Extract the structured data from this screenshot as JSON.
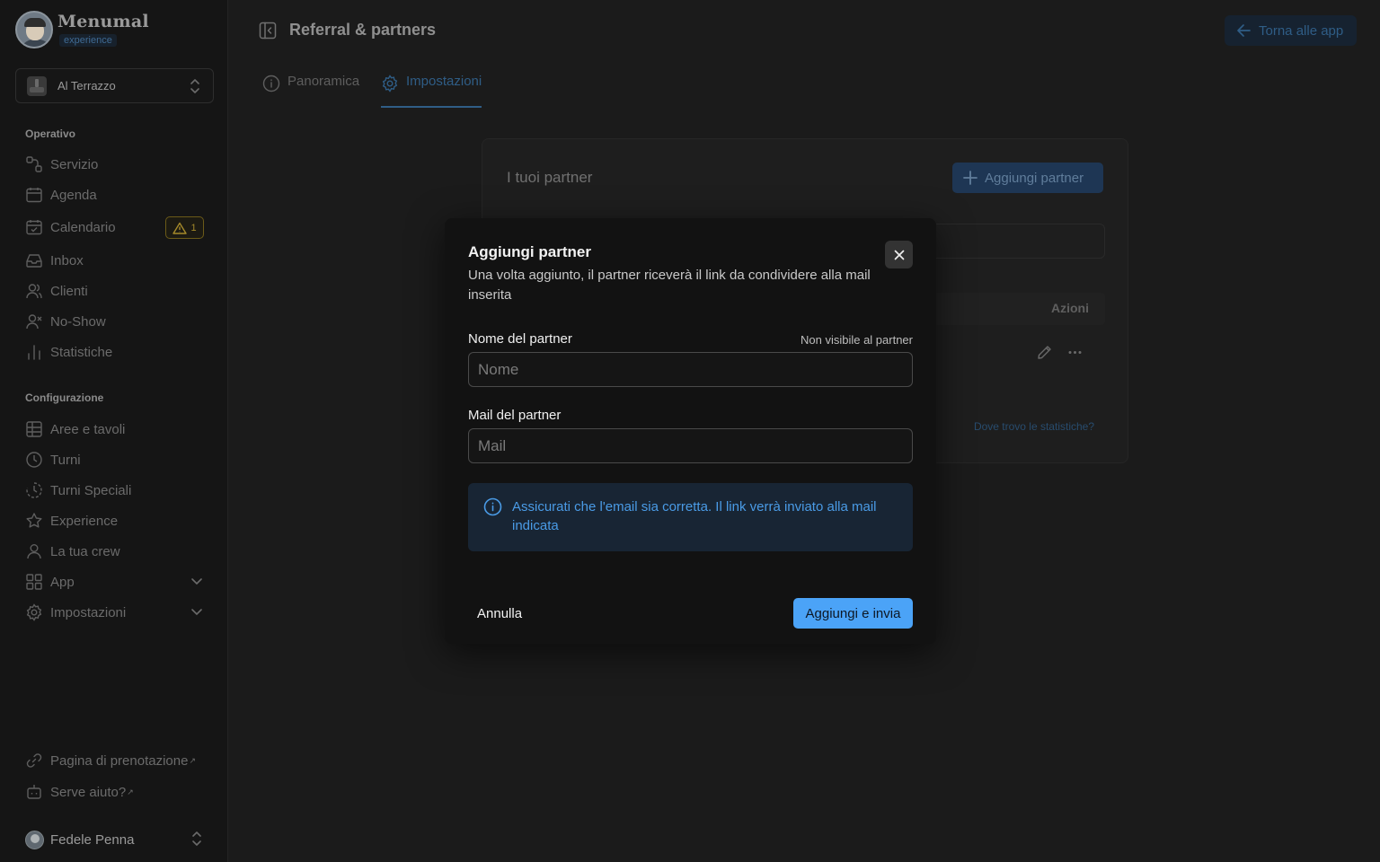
{
  "brand": {
    "name": "Menumal",
    "sub": "experience"
  },
  "venue": {
    "name": "Al Terrazzo"
  },
  "sidebar": {
    "sections": [
      {
        "title": "Operativo"
      },
      {
        "title": "Configurazione"
      }
    ],
    "operativo": [
      {
        "label": "Servizio",
        "icon": "service-icon"
      },
      {
        "label": "Agenda",
        "icon": "calendar-icon"
      },
      {
        "label": "Calendario",
        "icon": "calendar-check-icon",
        "badge": "1"
      },
      {
        "label": "Inbox",
        "icon": "inbox-icon"
      },
      {
        "label": "Clienti",
        "icon": "users-icon"
      },
      {
        "label": "No-Show",
        "icon": "user-x-icon"
      },
      {
        "label": "Statistiche",
        "icon": "bar-chart-icon"
      }
    ],
    "configurazione": [
      {
        "label": "Aree e tavoli",
        "icon": "grid-icon"
      },
      {
        "label": "Turni",
        "icon": "clock-icon"
      },
      {
        "label": "Turni Speciali",
        "icon": "clock-dashed-icon"
      },
      {
        "label": "Experience",
        "icon": "star-icon"
      },
      {
        "label": "La tua crew",
        "icon": "user-icon"
      },
      {
        "label": "App",
        "icon": "apps-icon"
      },
      {
        "label": "Impostazioni",
        "icon": "gear-icon"
      }
    ],
    "footer": [
      {
        "label": "Pagina di prenotazione",
        "icon": "link-icon"
      },
      {
        "label": "Serve aiuto?",
        "icon": "robot-icon"
      }
    ],
    "user": {
      "name": "Fedele Penna"
    }
  },
  "header": {
    "title": "Referral & partners",
    "back_label": "Torna alle app"
  },
  "tabs": [
    {
      "label": "Panoramica",
      "active": false
    },
    {
      "label": "Impostazioni",
      "active": true
    }
  ],
  "card": {
    "title": "I tuoi partner",
    "add_button": "Aggiungi partner",
    "table_actions_header": "Azioni",
    "stats_link": "Dove trovo le statistiche?"
  },
  "modal": {
    "title": "Aggiungi partner",
    "description": "Una volta aggiunto, il partner riceverà il link da condividere alla mail inserita",
    "name_label": "Nome del partner",
    "name_hint": "Non visibile al partner",
    "name_placeholder": "Nome",
    "name_value": "",
    "mail_label": "Mail del partner",
    "mail_placeholder": "Mail",
    "mail_value": "",
    "info": "Assicurati che l'email sia corretta. Il link verrà inviato alla mail indicata",
    "cancel": "Annulla",
    "submit": "Aggiungi e invia"
  },
  "colors": {
    "accent": "#4ba3f7",
    "info_text": "#4a9be6",
    "warning": "#a58a2a"
  }
}
